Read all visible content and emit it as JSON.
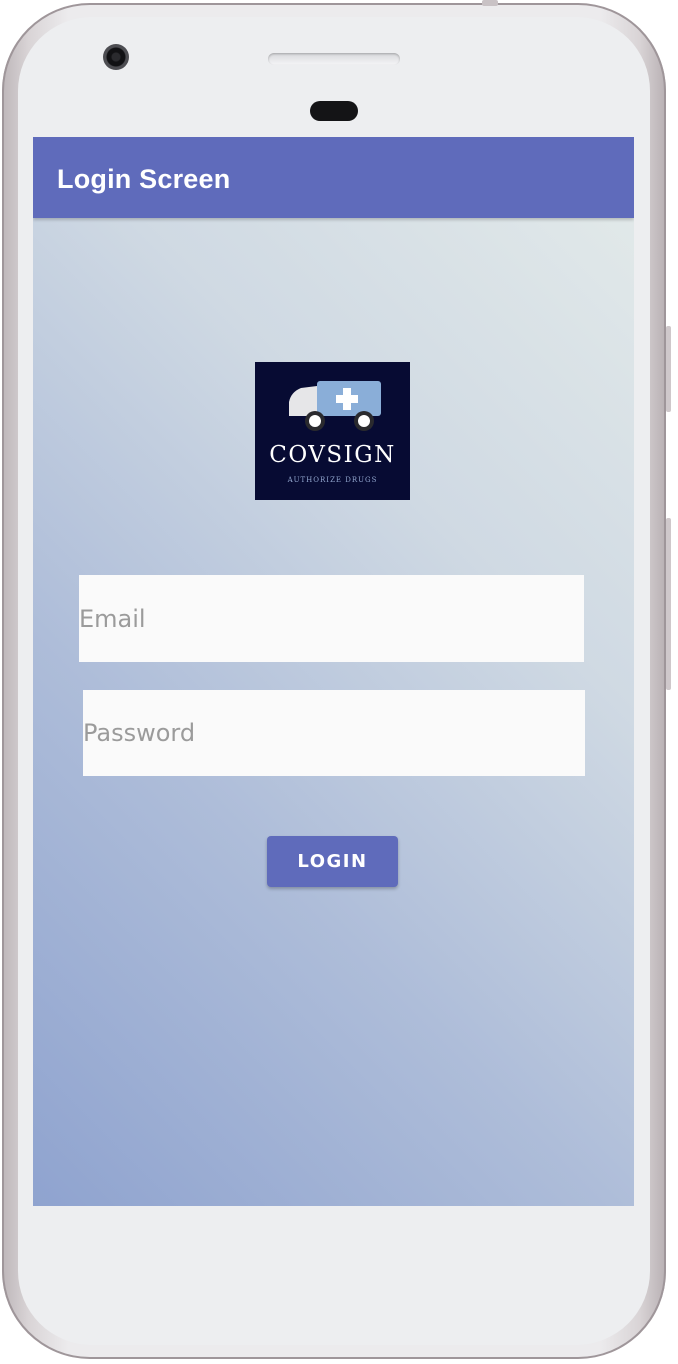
{
  "app_bar": {
    "title": "Login Screen"
  },
  "logo": {
    "name": "COVSIGN",
    "tagline": "AUTHORIZE DRUGS",
    "icon": "ambulance-icon"
  },
  "form": {
    "email_placeholder": "Email",
    "password_placeholder": "Password",
    "login_label": "LOGIN"
  },
  "colors": {
    "primary": "#5f6bbb",
    "logo_background": "#070b33",
    "logo_accent": "#8aaed8"
  }
}
